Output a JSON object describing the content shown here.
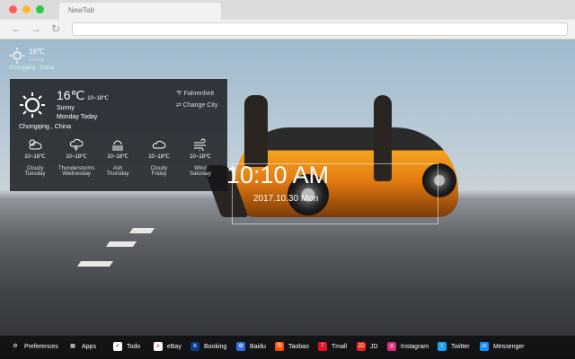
{
  "browser": {
    "tab_title": "NewTab"
  },
  "weather_mini": {
    "temp": "16℃",
    "cond": "Sunny",
    "location": "Chongqing · China"
  },
  "weather": {
    "temp": "16℃",
    "range": "10~18℃",
    "cond": "Sunny",
    "day": "Monday Today",
    "unit_option": "℉ Fahrenheit",
    "city_option": "⇄ Change City",
    "city": "Chongqing , China",
    "forecast": [
      {
        "range": "10~18℃",
        "cond": "Cloudy",
        "day": "Tuesday",
        "icon": "cloudy-sun-icon"
      },
      {
        "range": "10~18℃",
        "cond": "Thunderstorms",
        "day": "Wednesday",
        "icon": "thunder-icon"
      },
      {
        "range": "10~18℃",
        "cond": "Ash",
        "day": "Thursday",
        "icon": "ash-icon"
      },
      {
        "range": "10~18℃",
        "cond": "Cloudy",
        "day": "Friday",
        "icon": "cloud-icon"
      },
      {
        "range": "10~18℃",
        "cond": "Wind",
        "day": "Saturday",
        "icon": "wind-icon"
      }
    ]
  },
  "clock": {
    "time": "10:10 AM",
    "date": "2017.10.30 Mon"
  },
  "bottombar": [
    {
      "label": "Preferences",
      "icon": "gear-icon",
      "color": "#2b2b2b"
    },
    {
      "label": "Apps",
      "icon": "apps-grid-icon",
      "color": "#2b2b2b"
    },
    {
      "label": "Todo",
      "icon": "todo-check-icon",
      "color": "#ffffff"
    },
    {
      "label": "eBay",
      "icon": "ebay-icon",
      "color": "#ffffff"
    },
    {
      "label": "Booking",
      "icon": "booking-icon",
      "color": "#0b3a8a"
    },
    {
      "label": "Baidu",
      "icon": "baidu-icon",
      "color": "#2d6ee6"
    },
    {
      "label": "Taobao",
      "icon": "taobao-icon",
      "color": "#ff5000"
    },
    {
      "label": "Tmall",
      "icon": "tmall-icon",
      "color": "#e0102a"
    },
    {
      "label": "JD",
      "icon": "jd-icon",
      "color": "#e1251b"
    },
    {
      "label": "Instagram",
      "icon": "instagram-icon",
      "color": "#d62f7a"
    },
    {
      "label": "Twitter",
      "icon": "twitter-icon",
      "color": "#1da1f2"
    },
    {
      "label": "Messenger",
      "icon": "messenger-icon",
      "color": "#1a8cff"
    }
  ]
}
